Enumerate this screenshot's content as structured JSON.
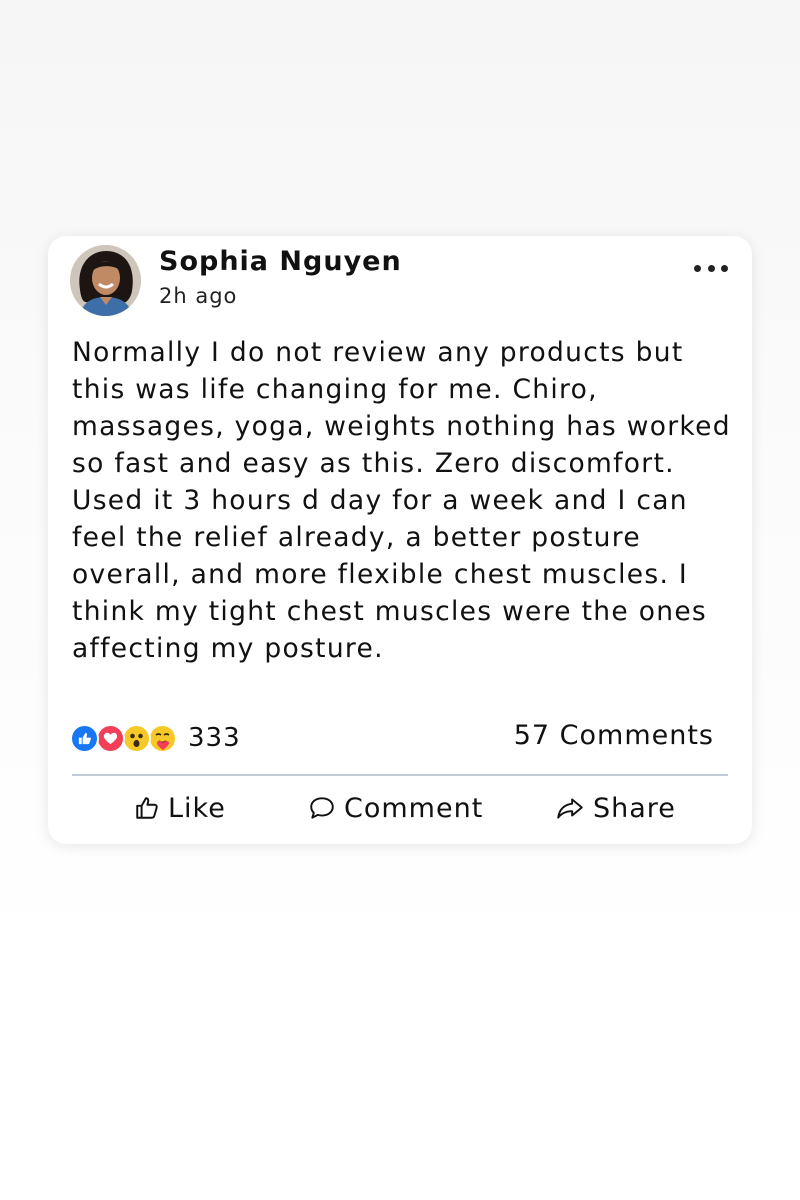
{
  "post": {
    "author": "Sophia Nguyen",
    "timestamp": "2h ago",
    "avatar_icon": "profile-photo",
    "more_icon": "more-horizontal-icon",
    "body": "Normally I do not review any products but this was life changing for me. Chiro, massages, yoga, weights nothing has worked so fast and easy as this. Zero discomfort. Used it 3 hours d day for a week and I can feel the relief already, a better posture overall, and more flexible chest muscles. I think my tight chest muscles were the ones affecting my posture."
  },
  "reactions": {
    "icons": [
      "like-icon",
      "love-icon",
      "wow-icon",
      "care-icon"
    ],
    "count": "333"
  },
  "comments": {
    "count_label": "57 Comments"
  },
  "actions": {
    "like": "Like",
    "comment": "Comment",
    "share": "Share"
  },
  "colors": {
    "like": "#1877F2",
    "love": "#F33E58",
    "wow": "#F7C928",
    "divider": "#C4CBD8"
  }
}
